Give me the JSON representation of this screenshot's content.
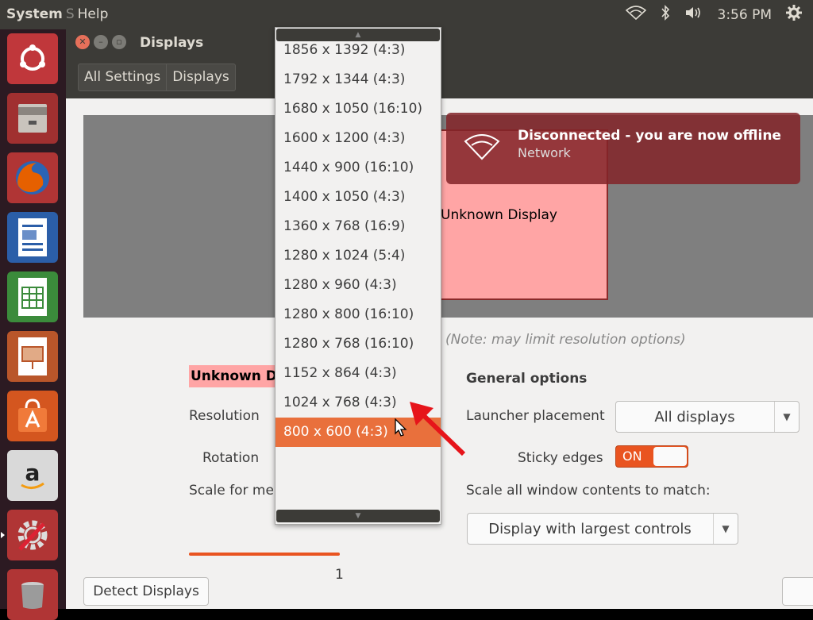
{
  "topbar": {
    "menu_system": "System",
    "menu_sep": "S",
    "menu_help": "Help",
    "clock": "3:56 PM"
  },
  "launcher": {
    "items": [
      "ubuntu-dash",
      "files",
      "firefox",
      "libreoffice-writer",
      "libreoffice-calc",
      "libreoffice-impress",
      "ubuntu-software-center",
      "amazon",
      "system-settings",
      "trash"
    ]
  },
  "window": {
    "title": "Displays",
    "breadcrumb": [
      "All Settings",
      "Displays"
    ]
  },
  "preview": {
    "display_label": "Unknown Display"
  },
  "note": "(Note: may limit resolution options)",
  "display_section": {
    "name": "Unknown Di",
    "resolution_label": "Resolution",
    "rotation_label": "Rotation",
    "scale_label": "Scale for me",
    "scale_value": "1"
  },
  "general": {
    "heading": "General options",
    "launcher_label": "Launcher placement",
    "launcher_value": "All displays",
    "sticky_label": "Sticky edges",
    "sticky_state": "ON",
    "scale_all_label": "Scale all window contents to match:",
    "scale_all_value": "Display with largest controls"
  },
  "buttons": {
    "detect": "Detect Displays"
  },
  "resolution_menu": {
    "options": [
      "1856 x 1392 (4:3)",
      "1792 x 1344 (4:3)",
      "1680 x 1050 (16:10)",
      "1600 x 1200 (4:3)",
      "1440 x 900 (16:10)",
      "1400 x 1050 (4:3)",
      "1360 x 768 (16:9)",
      "1280 x 1024 (5:4)",
      "1280 x 960 (4:3)",
      "1280 x 800 (16:10)",
      "1280 x 768 (16:10)",
      "1152 x 864 (4:3)",
      "1024 x 768 (4:3)",
      "800 x 600 (4:3)"
    ],
    "selected_index": 13
  },
  "notification": {
    "title": "Disconnected - you are now offline",
    "subtitle": "Network"
  },
  "colors": {
    "accent": "#e95420",
    "highlight": "#e9703c",
    "panel": "#3c3b37",
    "monitor_fill": "#ffa5a5"
  }
}
